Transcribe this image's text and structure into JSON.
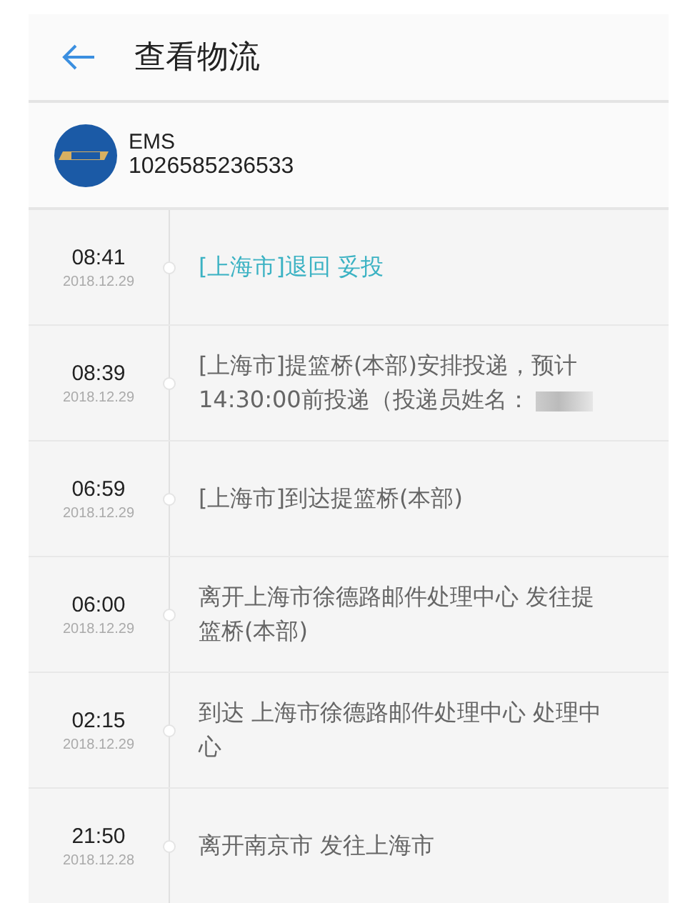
{
  "header": {
    "title": "查看物流"
  },
  "carrier": {
    "name": "EMS",
    "tracking_number": "1026585236533"
  },
  "events": [
    {
      "time": "08:41",
      "date": "2018.12.29",
      "text": "[上海市]退回 妥投",
      "current": true,
      "redacted": false
    },
    {
      "time": "08:39",
      "date": "2018.12.29",
      "text": "[上海市]提篮桥(本部)安排投递，预计14:30:00前投递（投递员姓名：",
      "current": false,
      "redacted": true
    },
    {
      "time": "06:59",
      "date": "2018.12.29",
      "text": "[上海市]到达提篮桥(本部)",
      "current": false,
      "redacted": false
    },
    {
      "time": "06:00",
      "date": "2018.12.29",
      "text": "离开上海市徐德路邮件处理中心 发往提篮桥(本部)",
      "current": false,
      "redacted": false
    },
    {
      "time": "02:15",
      "date": "2018.12.29",
      "text": "到达 上海市徐德路邮件处理中心 处理中心",
      "current": false,
      "redacted": false
    },
    {
      "time": "21:50",
      "date": "2018.12.28",
      "text": "离开南京市 发往上海市",
      "current": false,
      "redacted": false
    }
  ]
}
